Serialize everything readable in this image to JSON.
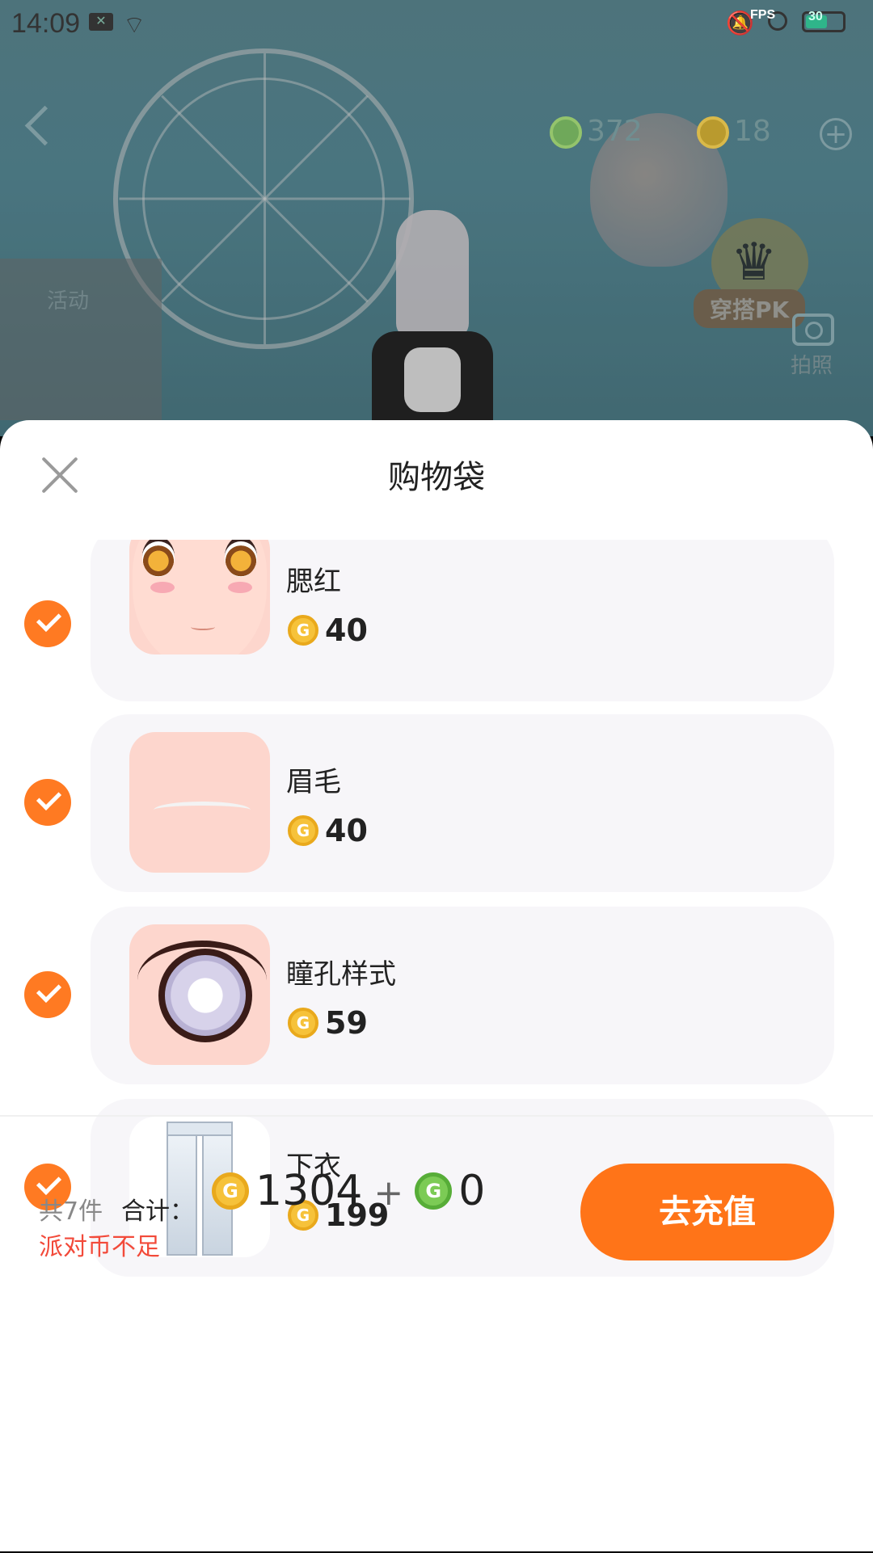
{
  "status_bar": {
    "time": "14:09",
    "fps_label": "FPS",
    "battery_text": "30"
  },
  "hud": {
    "green_currency": "372",
    "gold_currency": "18",
    "activity_label": "活动",
    "pk_label": "穿搭PK",
    "camera_label": "拍照"
  },
  "sheet": {
    "title": "购物袋",
    "items": [
      {
        "name": "腮红",
        "price": "40",
        "checked": true
      },
      {
        "name": "眉毛",
        "price": "40",
        "checked": true
      },
      {
        "name": "瞳孔样式",
        "price": "59",
        "checked": true
      },
      {
        "name": "下衣",
        "price": "199",
        "checked": true
      }
    ]
  },
  "footer": {
    "count": "共7件",
    "total_label": "合计：",
    "gold_total": "1304",
    "plus": "+",
    "green_total": "0",
    "warning": "派对币不足",
    "recharge_label": "去充值"
  },
  "colors": {
    "accent": "#ff7418",
    "warning": "#f24a3a",
    "card_bg": "#f7f6f9"
  }
}
